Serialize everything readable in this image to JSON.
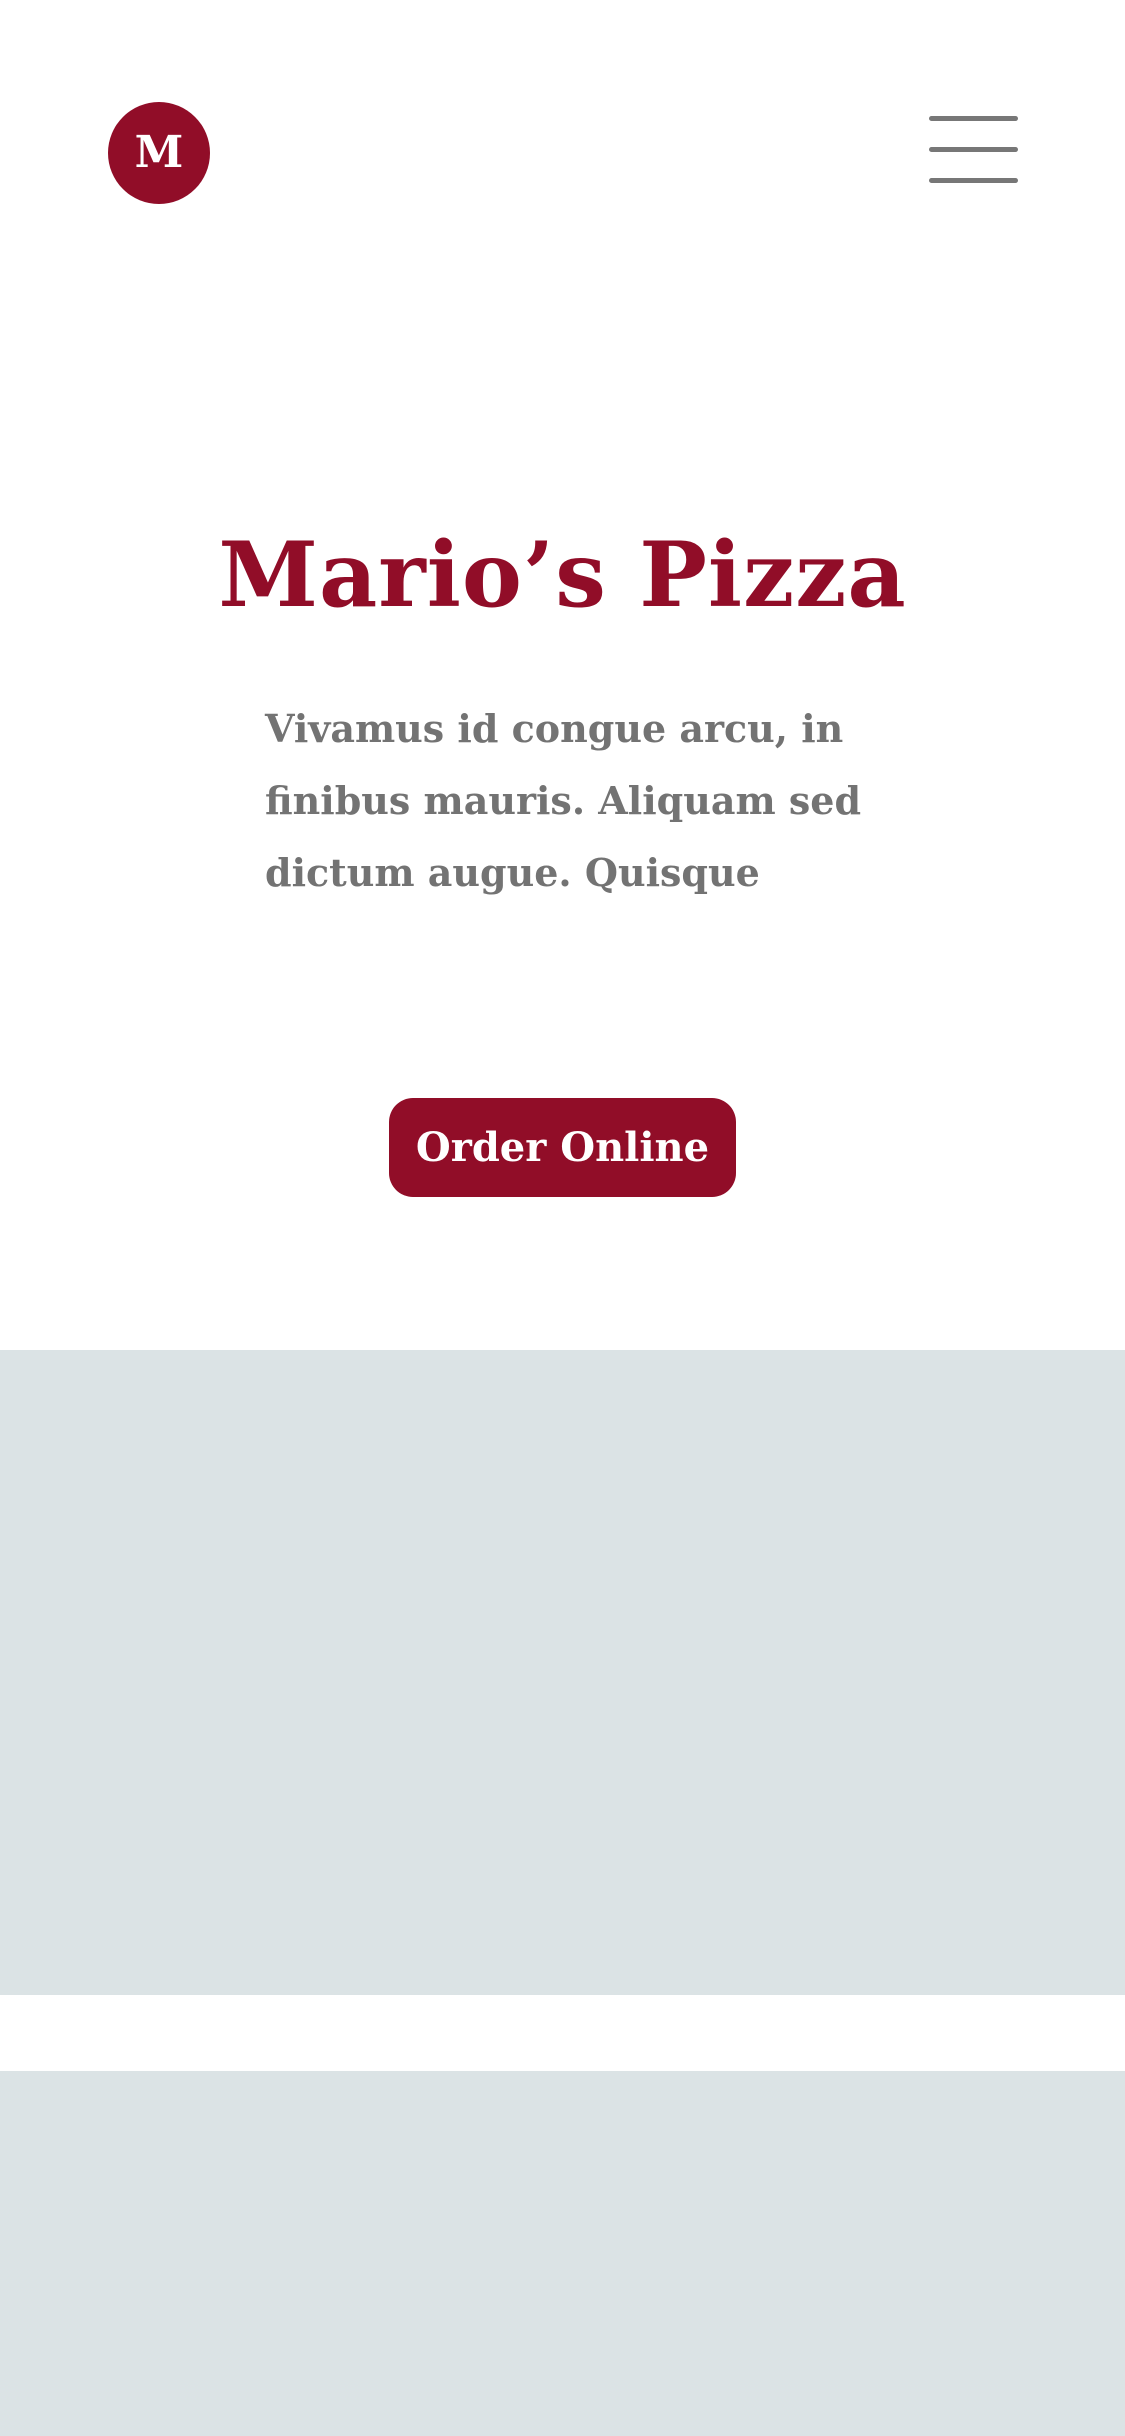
{
  "brand": {
    "logo_letter": "M",
    "accent_color": "#910d28"
  },
  "header": {
    "menu_icon": "hamburger-menu-icon"
  },
  "hero": {
    "title": "Mario’s Pizza",
    "body": "Vivamus id congue arcu, in finibus mauris. Aliquam sed dictum augue. Quisque",
    "cta_label": "Order Online"
  },
  "colors": {
    "accent": "#910d28",
    "body_text": "#737373",
    "placeholder": "#dbe3e5",
    "background": "#ffffff"
  }
}
